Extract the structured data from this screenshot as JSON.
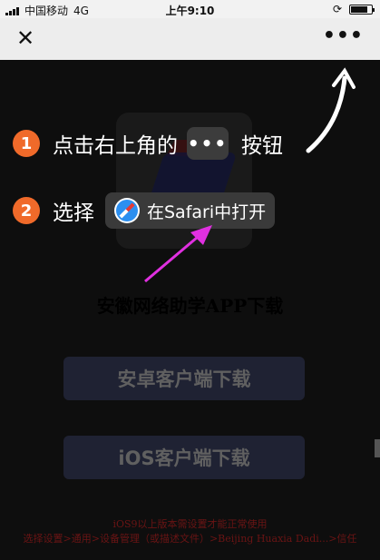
{
  "status_bar": {
    "carrier": "中国移动",
    "network": "4G",
    "time": "上午9:10",
    "battery_level": 0.8
  },
  "nav": {
    "close_icon": "close-icon",
    "more_icon": "more-icon"
  },
  "guide": {
    "step1": {
      "number": "1",
      "before": "点击右上角的",
      "chip": "•••",
      "after": "按钮"
    },
    "step2": {
      "number": "2",
      "before": "选择",
      "chip_label": "在Safari中打开"
    }
  },
  "page": {
    "title": "安徽网络助学APP下载",
    "android_button": "安卓客户端下载",
    "ios_button": "iOS客户端下载",
    "note_line1": "iOS9以上版本需设置才能正常使用",
    "note_line2": "选择设置>通用>设备管理（或描述文件）>Beijing Huaxia Dadi...>信任"
  },
  "colors": {
    "step_badge": "#f06a2a",
    "pointer_arrow": "#e030e0"
  }
}
